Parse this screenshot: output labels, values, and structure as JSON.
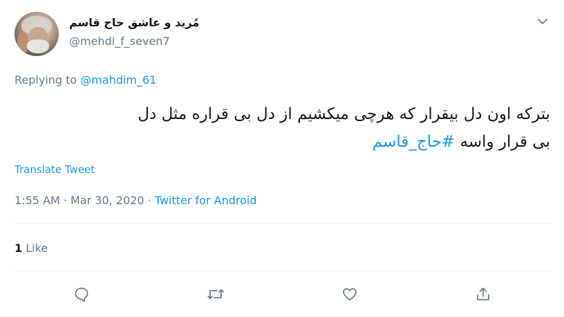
{
  "author": {
    "name": "مُرید و عاشق حاج قاسم",
    "handle": "@mehdi_f_seven7"
  },
  "reply": {
    "prefix": "Replying to",
    "to": "@mahdim_61"
  },
  "tweet": {
    "text_line1": "بترکه اون دل بیقرار که هرچی میکشیم از دل بی قراره مثل دل",
    "text_line2": "بی قرار واسه",
    "hashtag": "#حاج_قاسم"
  },
  "translate_label": "Translate Tweet",
  "meta": {
    "time": "1:55 AM",
    "separator1": " · ",
    "date": "Mar 30, 2020",
    "separator2": " · ",
    "source": "Twitter for Android"
  },
  "stats": {
    "likes_count": "1",
    "likes_label": "Like"
  },
  "actions": {
    "reply_icon": "reply-icon",
    "retweet_icon": "retweet-icon",
    "like_icon": "heart-icon",
    "share_icon": "share-icon"
  },
  "colors": {
    "link": "#1b95e0",
    "muted": "#657786",
    "text": "#14171a",
    "divider": "#e6ecf0"
  }
}
